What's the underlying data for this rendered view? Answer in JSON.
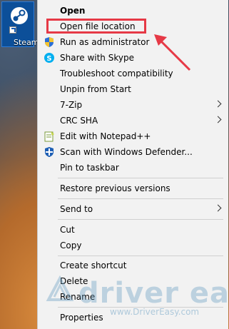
{
  "desktop": {
    "icon_label": "Steam"
  },
  "menu": {
    "items": [
      {
        "label": "Open",
        "bold": true
      },
      {
        "label": "Open file location"
      },
      {
        "label": "Run as administrator",
        "icon": "uac-shield-icon"
      },
      {
        "label": "Share with Skype",
        "icon": "skype-icon"
      },
      {
        "label": "Troubleshoot compatibility"
      },
      {
        "label": "Unpin from Start"
      },
      {
        "label": "7-Zip",
        "submenu": true
      },
      {
        "label": "CRC SHA",
        "submenu": true
      },
      {
        "label": "Edit with Notepad++",
        "icon": "notepadpp-icon"
      },
      {
        "label": "Scan with Windows Defender...",
        "icon": "defender-icon"
      },
      {
        "label": "Pin to taskbar"
      },
      {
        "label": "Restore previous versions"
      },
      {
        "label": "Send to",
        "submenu": true
      },
      {
        "label": "Cut"
      },
      {
        "label": "Copy"
      },
      {
        "label": "Create shortcut"
      },
      {
        "label": "Delete"
      },
      {
        "label": "Rename"
      },
      {
        "label": "Properties"
      }
    ]
  },
  "annotation": {
    "highlight_color": "#e63946"
  },
  "watermark": {
    "brand": "driver easy",
    "url": "www.DriverEasy.com"
  }
}
